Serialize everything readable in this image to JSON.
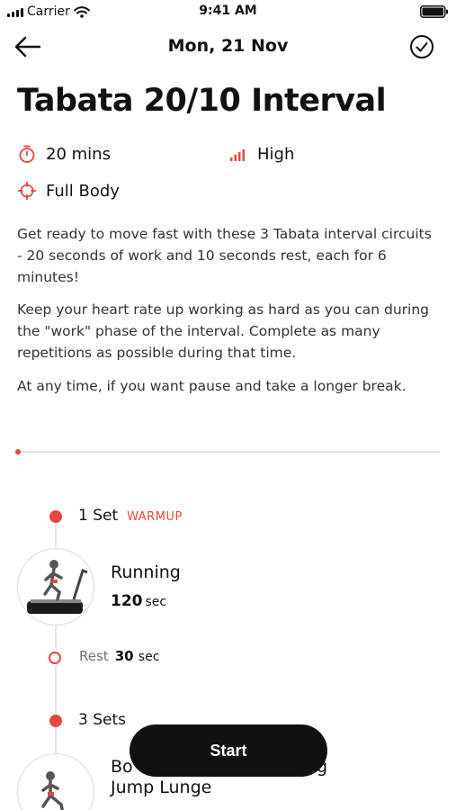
{
  "status_bar": {
    "carrier": "Carrier",
    "time": "9:41 AM"
  },
  "header": {
    "title": "Mon, 21 Nov"
  },
  "workout": {
    "title": "Tabata 20/10 Interval",
    "duration": "20 mins",
    "intensity": "High",
    "target": "Full Body",
    "description": [
      "Get ready to move fast with these 3 Tabata interval circuits - 20 seconds of work and 10 seconds rest, each for 6 minutes!",
      "Keep your heart rate up working as hard as you can during the \"work\" phase of the interval. Complete as many repetitions as possible during that time.",
      "At any time, if you want pause and take a longer break."
    ]
  },
  "progress": {
    "fraction": 0
  },
  "timeline": {
    "set1": {
      "label": "1 Set",
      "tag": "WARMUP"
    },
    "exercise1": {
      "name": "Running",
      "duration": "120",
      "unit": "sec"
    },
    "rest1": {
      "label": "Rest",
      "value": "30",
      "unit": "sec"
    },
    "set2": {
      "label": "3 Sets"
    },
    "exercise2": {
      "name_line1": "Bo",
      "name_line1_tail": "g",
      "name_line2": "Jump Lunge"
    }
  },
  "start_button": {
    "label": "Start"
  },
  "colors": {
    "accent": "#e8473d",
    "text": "#111111",
    "muted": "#6b7280"
  },
  "icons": [
    "back-arrow-icon",
    "checkmark-circle-icon",
    "stopwatch-icon",
    "intensity-bars-icon",
    "crosshair-icon"
  ]
}
